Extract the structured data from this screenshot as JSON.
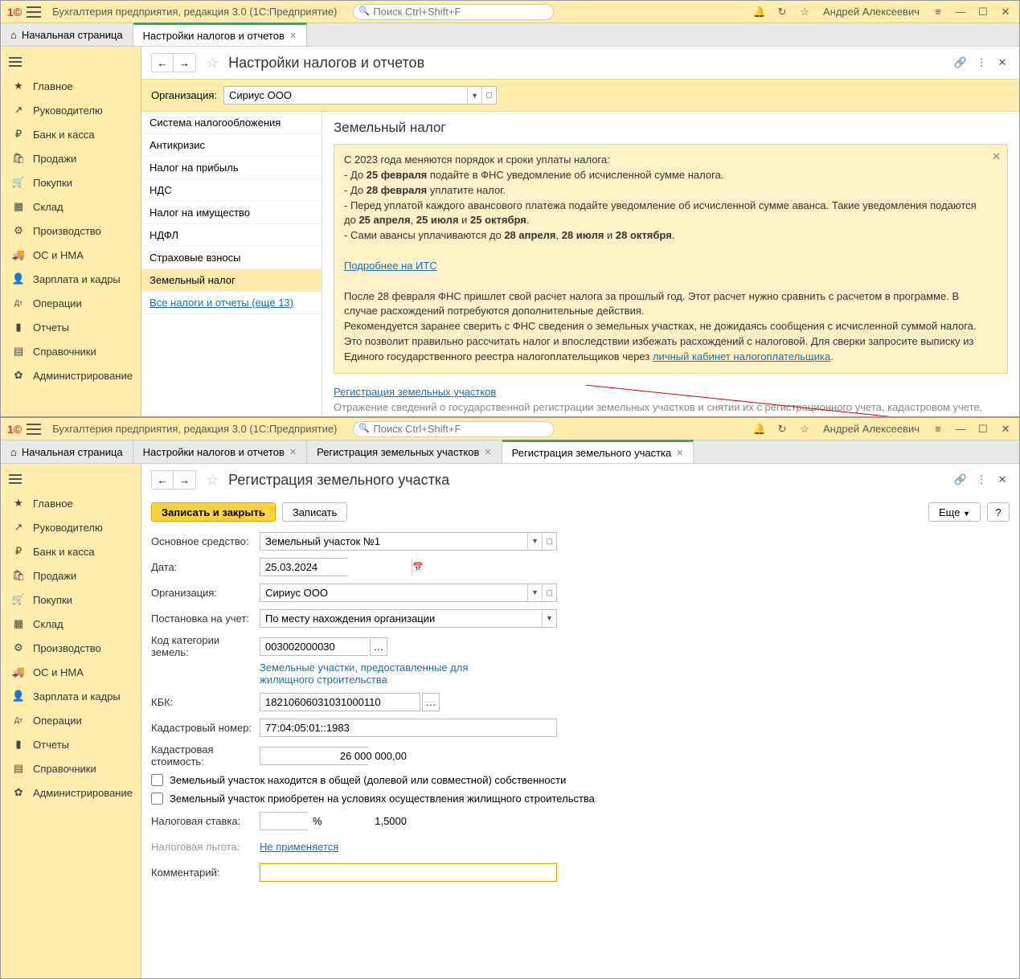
{
  "app": {
    "title": "Бухгалтерия предприятия, редакция 3.0  (1С:Предприятие)",
    "search_placeholder": "Поиск Ctrl+Shift+F",
    "user": "Андрей Алексеевич"
  },
  "sidebar": {
    "items": [
      {
        "label": "Главное",
        "icon": "★"
      },
      {
        "label": "Руководителю",
        "icon": "↗"
      },
      {
        "label": "Банк и касса",
        "icon": "₽"
      },
      {
        "label": "Продажи",
        "icon": "🛍"
      },
      {
        "label": "Покупки",
        "icon": "🛒"
      },
      {
        "label": "Склад",
        "icon": "▦"
      },
      {
        "label": "Производство",
        "icon": "⚙"
      },
      {
        "label": "ОС и НМА",
        "icon": "🚚"
      },
      {
        "label": "Зарплата и кадры",
        "icon": "👤"
      },
      {
        "label": "Операции",
        "icon": "Дт"
      },
      {
        "label": "Отчеты",
        "icon": "▮"
      },
      {
        "label": "Справочники",
        "icon": "▤"
      },
      {
        "label": "Администрирование",
        "icon": "✿"
      }
    ]
  },
  "window1": {
    "tabs": {
      "home": "Начальная страница",
      "settings": "Настройки налогов и отчетов"
    },
    "page_title": "Настройки налогов и отчетов",
    "org_label": "Организация:",
    "org_value": "Сириус ООО",
    "tax_menu": [
      "Система налогообложения",
      "Антикризис",
      "Налог на прибыль",
      "НДС",
      "Налог на имущество",
      "НДФЛ",
      "Страховые взносы",
      "Земельный налог"
    ],
    "tax_menu_link": "Все налоги и отчеты (еще 13)",
    "content": {
      "heading": "Земельный налог",
      "info_intro": "С 2023 года меняются порядок и сроки уплаты налога:",
      "info_l1_a": " - До ",
      "info_l1_b": "25 февраля",
      "info_l1_c": " подайте в ФНС уведомление об исчисленной сумме налога.",
      "info_l2_a": " - До ",
      "info_l2_b": "28 февраля",
      "info_l2_c": " уплатите налог.",
      "info_l3_a": " - Перед уплатой каждого авансового платежа подайте уведомление об исчисленной сумме аванса. Такие уведомления подаются до ",
      "info_l3_b": "25 апреля",
      "info_l3_c": ", ",
      "info_l3_d": "25 июля",
      "info_l3_e": " и ",
      "info_l3_f": "25 октября",
      "info_l3_g": ".",
      "info_l4_a": " - Сами авансы уплачиваются до ",
      "info_l4_b": "28 апреля",
      "info_l4_c": ", ",
      "info_l4_d": "28 июля",
      "info_l4_e": " и ",
      "info_l4_f": "28 октября",
      "info_l4_g": ".",
      "info_link": "Подробнее на ИТС",
      "info_para1": "После 28 февраля ФНС пришлет свой расчет налога за прошлый год. Этот расчет нужно сравнить с расчетом в программе. В случае расхождений потребуются дополнительные действия.",
      "info_para2_a": "Рекомендуется заранее сверить с ФНС сведения о земельных участках, не дожидаясь сообщения с исчисленной суммой налога. Это позволит правильно рассчитать налог и впоследствии избежать расхождений с налоговой. Для сверки запросите выписку из Единого государственного реестра налогоплательщиков через ",
      "info_para2_link": "личный кабинет налогоплательщика",
      "info_para2_b": ".",
      "reg_link": "Регистрация земельных участков",
      "reg_desc": "Отражение сведений о государственной регистрации земельных участков и снятии их с регистрационного учета, кадастровом учете, ставках налога и льготах."
    }
  },
  "window2": {
    "tabs": {
      "home": "Начальная страница",
      "settings": "Настройки налогов и отчетов",
      "list": "Регистрация земельных участков",
      "form": "Регистрация земельного участка"
    },
    "page_title": "Регистрация земельного участка",
    "buttons": {
      "save_close": "Записать и закрыть",
      "save": "Записать",
      "more": "Еще",
      "help": "?"
    },
    "form": {
      "asset_label": "Основное средство:",
      "asset_value": "Земельный участок №1",
      "date_label": "Дата:",
      "date_value": "25.03.2024",
      "org_label": "Организация:",
      "org_value": "Сириус ООО",
      "reg_label": "Постановка на учет:",
      "reg_value": "По месту нахождения организации",
      "cat_label": "Код категории земель:",
      "cat_value": "003002000030",
      "cat_hint": "Земельные участки, предоставленные для жилищного строительства",
      "kbk_label": "КБК:",
      "kbk_value": "18210606031031000110",
      "cad_num_label": "Кадастровый номер:",
      "cad_num_value": "77:04:05:01::1983",
      "cad_val_label": "Кадастровая стоимость:",
      "cad_val_value": "26 000 000,00",
      "chk1": "Земельный участок находится в общей (долевой или совместной) собственности",
      "chk2": "Земельный участок приобретен на условиях осуществления жилищного строительства",
      "rate_label": "Налоговая ставка:",
      "rate_value": "1,5000",
      "rate_pct": "%",
      "exempt_label": "Налоговая льгота:",
      "exempt_value": "Не применяется",
      "comment_label": "Комментарий:"
    }
  }
}
